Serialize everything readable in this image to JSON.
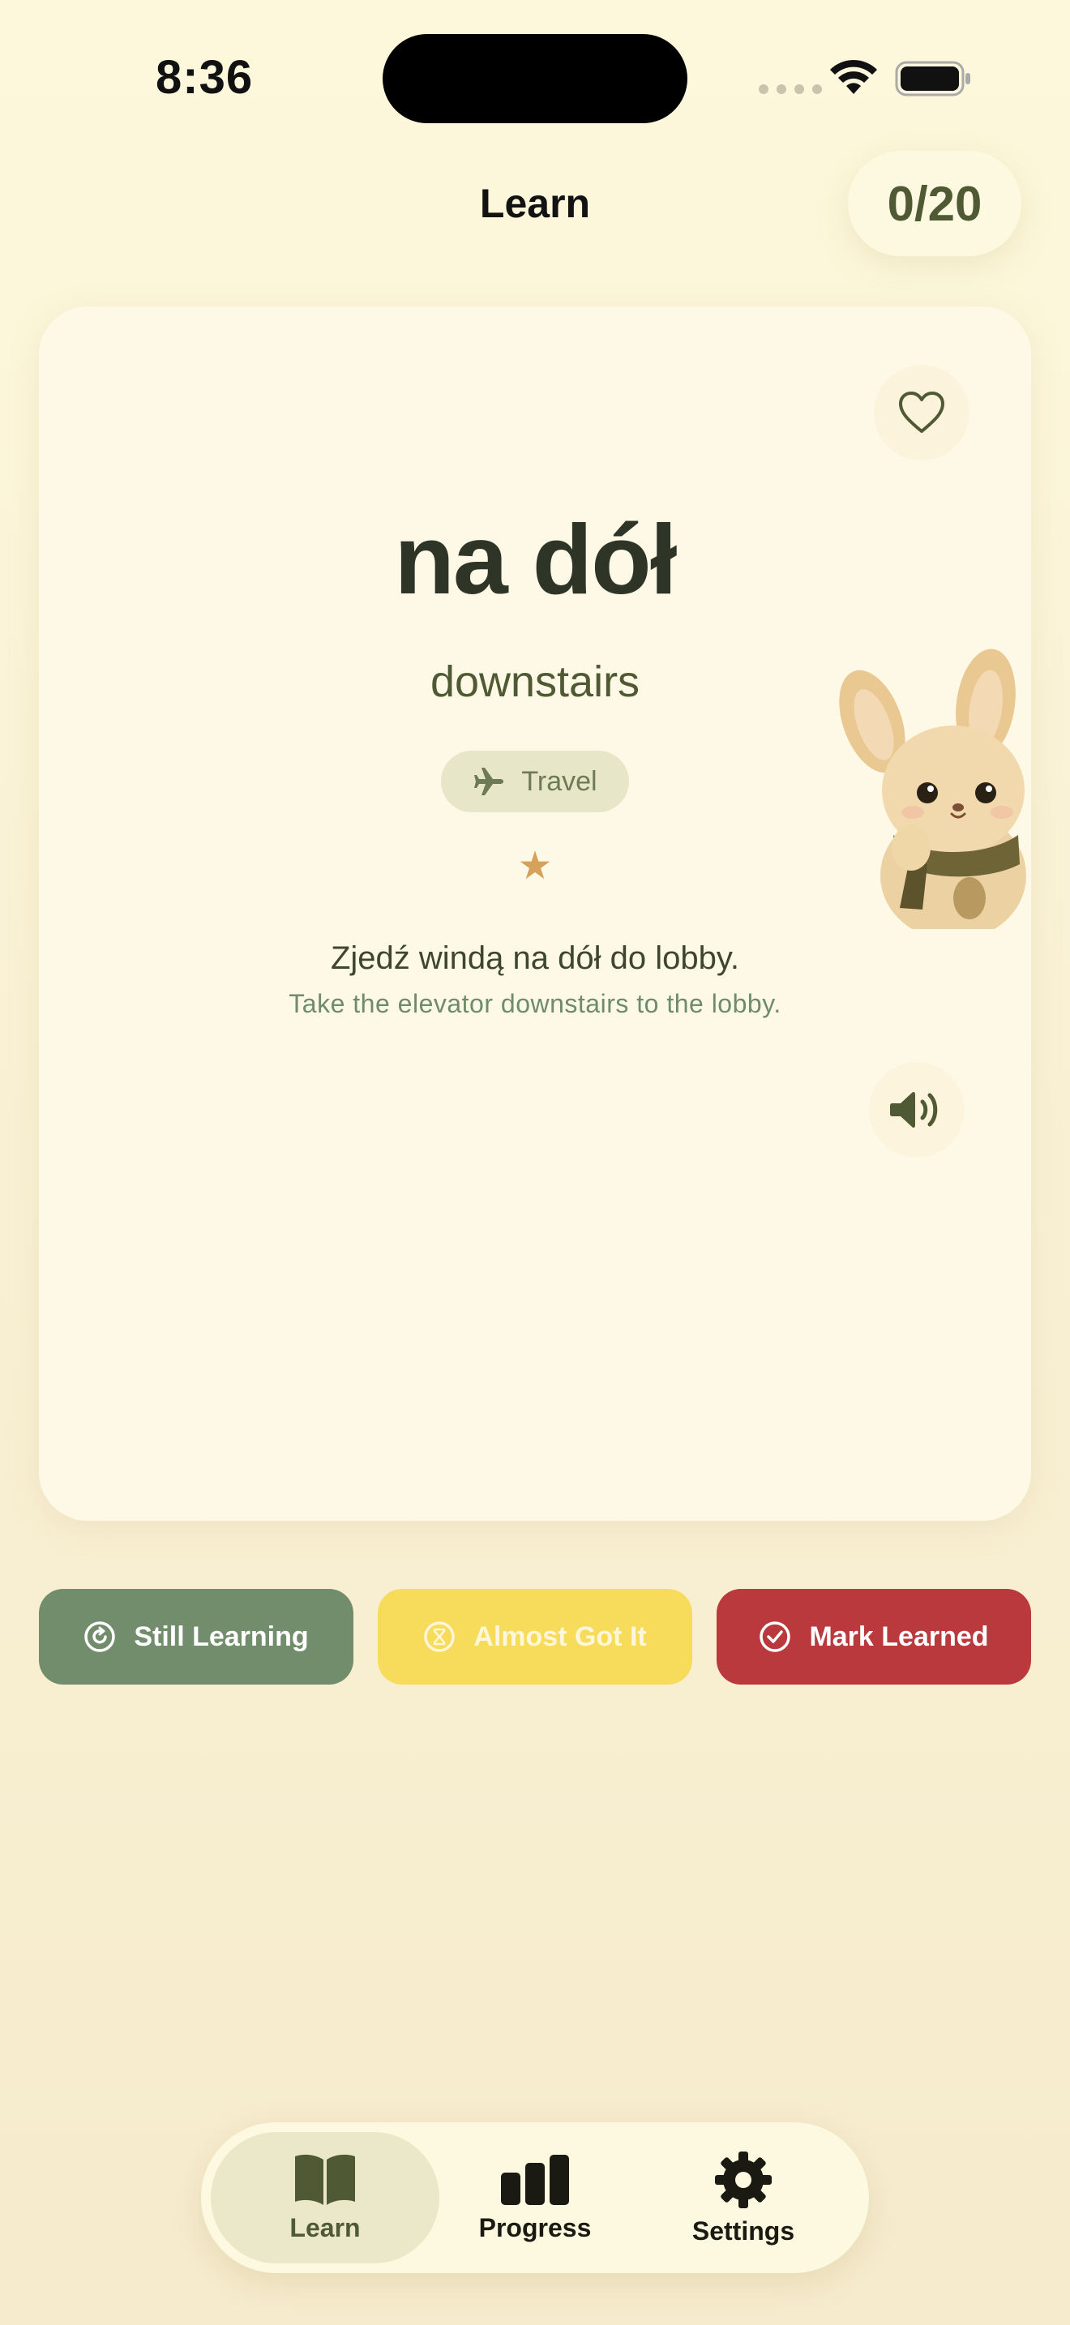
{
  "status_bar": {
    "time": "8:36"
  },
  "header": {
    "title": "Learn",
    "counter": "0/20"
  },
  "card": {
    "word": "na dół",
    "translation": "downstairs",
    "category": {
      "label": "Travel",
      "icon": "airplane-icon"
    },
    "rating_icon": "★",
    "example_sentence": "Zjedź windą na dół do lobby.",
    "example_translation": "Take the elevator downstairs to the lobby.",
    "favorite_icon": "heart-icon",
    "audio_icon": "speaker-icon"
  },
  "actions": {
    "still_learning": "Still Learning",
    "almost_got_it": "Almost Got It",
    "mark_learned": "Mark Learned"
  },
  "tabs": [
    {
      "label": "Learn",
      "icon": "book-icon",
      "active": true
    },
    {
      "label": "Progress",
      "icon": "bar-chart-icon",
      "active": false
    },
    {
      "label": "Settings",
      "icon": "gear-icon",
      "active": false
    }
  ],
  "colors": {
    "background": "#fdf8dc",
    "card": "#fef9e6",
    "still_learning": "#728d6c",
    "almost_got_it": "#f7dc5c",
    "mark_learned": "#b9393c",
    "accent_olive": "#4f5a34"
  }
}
